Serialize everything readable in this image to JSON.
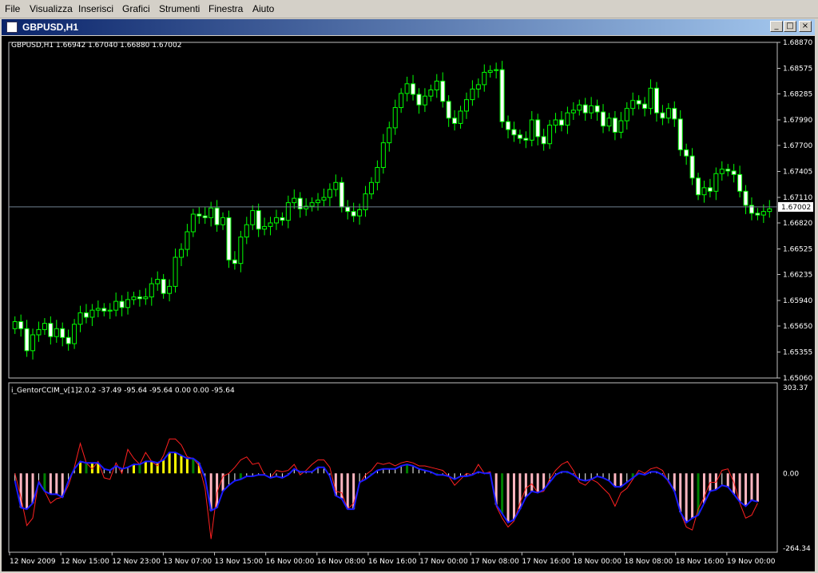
{
  "menu": [
    "File",
    "Visualizza",
    "Inserisci",
    "Grafici",
    "Strumenti",
    "Finestra",
    "Aiuto"
  ],
  "window": {
    "title": "GBPUSD,H1",
    "minimize": "_",
    "restore": "□",
    "close": "×"
  },
  "price_panel": {
    "header": "GBPUSD,H1  1.66942 1.67040 1.66880 1.67002",
    "current_price": "1.67002"
  },
  "indicator_panel": {
    "header": "i_GentorCCIM_v[1]2.0.2 -37.49 -95.64 -95.64 0.00 0.00 -95.64"
  },
  "colors": {
    "bull": "#000000",
    "bear": "#ffffff",
    "wick": "#00ff00",
    "cci_line": "#1a1aff",
    "signal_line": "#ff2020",
    "hist_yellow": "#ffff00",
    "hist_pink": "#ffb6c1",
    "hist_white": "#ffffff",
    "hist_green": "#008000"
  },
  "chart_data": [
    {
      "type": "line",
      "title": "GBPUSD,H1",
      "ylim": [
        1.6506,
        1.6887
      ],
      "y_ticks": [
        "1.68870",
        "1.68575",
        "1.68285",
        "1.67990",
        "1.67700",
        "1.67405",
        "1.67110",
        "1.66820",
        "1.66525",
        "1.66235",
        "1.65940",
        "1.65650",
        "1.65355",
        "1.65060"
      ],
      "x_labels": [
        "12 Nov 2009",
        "12 Nov 15:00",
        "12 Nov 23:00",
        "13 Nov 07:00",
        "13 Nov 15:00",
        "16 Nov 00:00",
        "16 Nov 08:00",
        "16 Nov 16:00",
        "17 Nov 00:00",
        "17 Nov 08:00",
        "17 Nov 16:00",
        "18 Nov 00:00",
        "18 Nov 08:00",
        "18 Nov 16:00",
        "19 Nov 00:00"
      ],
      "close": [
        1.657,
        1.6562,
        1.6537,
        1.6555,
        1.6561,
        1.6568,
        1.6553,
        1.6562,
        1.6552,
        1.6545,
        1.6567,
        1.658,
        1.6575,
        1.6583,
        1.6585,
        1.6582,
        1.6583,
        1.6593,
        1.6586,
        1.6595,
        1.6598,
        1.6596,
        1.6598,
        1.6613,
        1.6618,
        1.6602,
        1.661,
        1.6643,
        1.6652,
        1.6672,
        1.6692,
        1.669,
        1.6688,
        1.6699,
        1.668,
        1.6688,
        1.664,
        1.6636,
        1.6666,
        1.668,
        1.6696,
        1.6675,
        1.6678,
        1.6682,
        1.6688,
        1.6685,
        1.6705,
        1.671,
        1.6698,
        1.6701,
        1.6705,
        1.6708,
        1.6711,
        1.672,
        1.6728,
        1.67,
        1.6695,
        1.669,
        1.6697,
        1.6715,
        1.6728,
        1.6745,
        1.6773,
        1.679,
        1.6813,
        1.6829,
        1.684,
        1.6828,
        1.6816,
        1.6826,
        1.6833,
        1.6843,
        1.682,
        1.6801,
        1.6795,
        1.6809,
        1.6822,
        1.6834,
        1.6839,
        1.6853,
        1.6855,
        1.6856,
        1.6797,
        1.6788,
        1.6782,
        1.6778,
        1.6776,
        1.6799,
        1.678,
        1.6772,
        1.6793,
        1.6799,
        1.6793,
        1.6807,
        1.681,
        1.6816,
        1.6807,
        1.6815,
        1.6808,
        1.6792,
        1.6801,
        1.6785,
        1.6798,
        1.6812,
        1.6821,
        1.6817,
        1.6812,
        1.6835,
        1.6807,
        1.6801,
        1.6812,
        1.68,
        1.6765,
        1.6758,
        1.6733,
        1.6714,
        1.6722,
        1.6718,
        1.6738,
        1.6743,
        1.6741,
        1.6737,
        1.6718,
        1.6702,
        1.6693,
        1.6691,
        1.6695,
        1.6698
      ],
      "signal": [
        0,
        -80,
        -175,
        -150,
        -25,
        -60,
        -100,
        -85,
        -80,
        -40,
        20,
        100,
        35,
        15,
        40,
        -15,
        -20,
        35,
        0,
        80,
        50,
        30,
        70,
        40,
        25,
        60,
        115,
        115,
        95,
        55,
        50,
        25,
        -50,
        -220,
        -65,
        -10,
        0,
        20,
        45,
        55,
        30,
        35,
        -5,
        -15,
        10,
        5,
        10,
        30,
        -5,
        10,
        30,
        45,
        45,
        20,
        -60,
        -65,
        -120,
        -100,
        -35,
        -5,
        10,
        35,
        30,
        35,
        25,
        35,
        40,
        35,
        25,
        25,
        20,
        15,
        10,
        -10,
        -40,
        -20,
        0,
        -5,
        30,
        0,
        5,
        -110,
        -150,
        -180,
        -160,
        -100,
        -50,
        -35,
        -65,
        -60,
        -20,
        10,
        30,
        40,
        10,
        -30,
        -40,
        -20,
        -30,
        -50,
        -70,
        -110,
        -65,
        -50,
        -20,
        10,
        0,
        15,
        20,
        10,
        -30,
        -60,
        -130,
        -180,
        -190,
        -120,
        -80,
        -30,
        -30,
        10,
        15,
        -30,
        -100,
        -150,
        -140,
        -100
      ],
      "cci": [
        -25,
        -115,
        -120,
        -100,
        -30,
        -60,
        -70,
        -70,
        -80,
        -25,
        15,
        40,
        35,
        35,
        35,
        15,
        10,
        25,
        15,
        20,
        30,
        30,
        40,
        40,
        35,
        45,
        70,
        70,
        60,
        50,
        50,
        35,
        -15,
        -125,
        -115,
        -60,
        -40,
        -25,
        -20,
        -10,
        -10,
        -5,
        -5,
        -15,
        -10,
        -15,
        -5,
        15,
        5,
        5,
        5,
        20,
        20,
        -10,
        -75,
        -85,
        -120,
        -120,
        -30,
        -20,
        -5,
        10,
        15,
        15,
        15,
        25,
        30,
        25,
        15,
        10,
        5,
        -5,
        -5,
        -10,
        -20,
        -10,
        -10,
        -5,
        5,
        0,
        0,
        -105,
        -135,
        -165,
        -155,
        -120,
        -80,
        -60,
        -65,
        -55,
        -30,
        -5,
        5,
        5,
        -5,
        -20,
        -25,
        -20,
        -10,
        -15,
        -25,
        -45,
        -45,
        -30,
        -15,
        0,
        -5,
        5,
        5,
        -5,
        -25,
        -60,
        -130,
        -165,
        -150,
        -140,
        -100,
        -60,
        -55,
        -40,
        -45,
        -70,
        -95,
        -110,
        -90,
        -95
      ],
      "cci_ylim": [
        -264.34,
        303.37
      ]
    }
  ]
}
